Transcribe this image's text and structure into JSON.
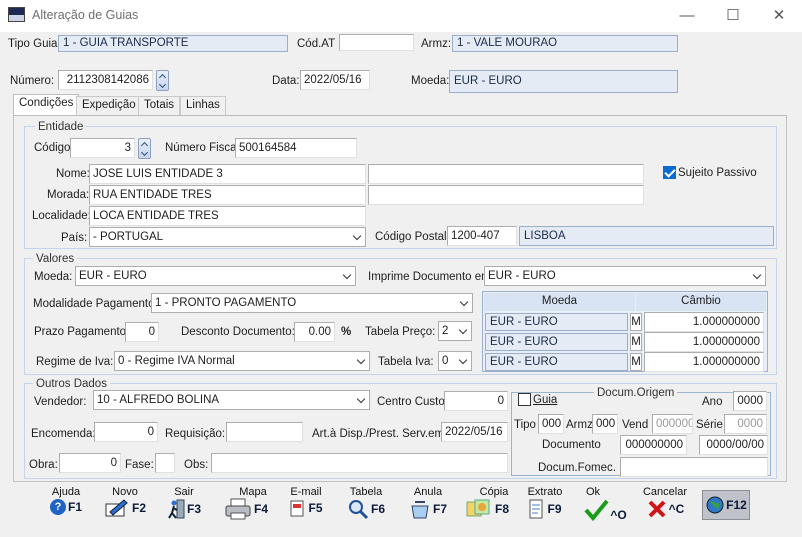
{
  "window": {
    "title": "Alteração de Guias",
    "minimize": "—",
    "maximize": "☐",
    "close": "✕"
  },
  "header": {
    "tipo_guia_label": "Tipo Guia:",
    "tipo_guia_value": "1 - GUIA TRANSPORTE",
    "cod_at_label": "Cód.AT",
    "cod_at_value": "",
    "armz_label": "Armz:",
    "armz_value": "1 - VALE MOURAO",
    "numero_label": "Número:",
    "numero_value": "2112308142086",
    "data_label": "Data:",
    "data_value": "2022/05/16",
    "moeda_label": "Moeda:",
    "moeda_value": "EUR - EURO"
  },
  "tabs": [
    {
      "label": "Condições",
      "active": true
    },
    {
      "label": "Expedição"
    },
    {
      "label": "Totais"
    },
    {
      "label": "Linhas"
    }
  ],
  "entidade": {
    "group_label": "Entidade",
    "codigo_label": "Código:",
    "codigo_value": "3",
    "nif_label": "Número Fiscal:",
    "nif_value": "500164584",
    "nome_label": "Nome:",
    "nome_value": "JOSE LUIS ENTIDADE 3",
    "nome2_value": "",
    "morada_label": "Morada:",
    "morada_value": "RUA ENTIDADE TRES",
    "morada2_value": "",
    "localidade_label": "Localidade:",
    "localidade_value": "LOCA ENTIDADE TRES",
    "pais_label": "País:",
    "pais_value": "- PORTUGAL",
    "cp_label": "Código Postal:",
    "cp_value": "1200-407",
    "cp_localidade": "LISBOA",
    "sujeito_passivo_label": "Sujeito Passivo",
    "sujeito_passivo_checked": true
  },
  "valores": {
    "group_label": "Valores",
    "moeda_label": "Moeda:",
    "moeda_value": "EUR - EURO",
    "imprime_label": "Imprime Documento em:",
    "imprime_value": "EUR - EURO",
    "modalidade_label": "Modalidade Pagamento:",
    "modalidade_value": "1 - PRONTO PAGAMENTO",
    "prazo_label": "Prazo Pagamento:",
    "prazo_value": "0",
    "desconto_label": "Desconto Documento:",
    "desconto_value": "0.00",
    "percent": "%",
    "tabela_preco_label": "Tabela Preço:",
    "tabela_preco_value": "2",
    "regime_label": "Regime de Iva:",
    "regime_value": "0 - Regime IVA Normal",
    "tabela_iva_label": "Tabela Iva:",
    "tabela_iva_value": "0",
    "table": {
      "headers": [
        "Moeda",
        "Câmbio"
      ],
      "rows": [
        {
          "moeda": "EUR - EURO",
          "m": "M",
          "cambio": "1.000000000"
        },
        {
          "moeda": "EUR - EURO",
          "m": "M",
          "cambio": "1.000000000"
        },
        {
          "moeda": "EUR - EURO",
          "m": "M",
          "cambio": "1.000000000"
        }
      ]
    }
  },
  "outros": {
    "group_label": "Outros Dados",
    "vendedor_label": "Vendedor:",
    "vendedor_value": "10 - ALFREDO BOLINA",
    "centro_label": "Centro Custo:",
    "centro_value": "0",
    "encomenda_label": "Encomenda:",
    "encomenda_value": "0",
    "requisicao_label": "Requisição:",
    "requisicao_value": "",
    "art_label": "Art.à Disp./Prest. Serv.em:",
    "art_value": "2022/05/16",
    "obra_label": "Obra:",
    "obra_value": "0",
    "fase_label": "Fase:",
    "fase_value": "",
    "obs_label": "Obs:",
    "obs_value": ""
  },
  "origem": {
    "guia_label": "Guia",
    "guia_checked": false,
    "title": "Docum.Origem",
    "ano_label": "Ano",
    "ano_value": "0000",
    "tipo_label": "Tipo",
    "tipo_value": "000",
    "armz_label": "Armz",
    "armz_value": "000",
    "vend_label": "Vend",
    "vend_value": "000000",
    "serie_label": "Série",
    "serie_value": "0000",
    "documento_label": "Documento",
    "documento_value": "000000000",
    "documento_data": "0000/00/00",
    "fornec_label": "Docum.Fomec.",
    "fornec_value": ""
  },
  "fkeys": [
    {
      "caption": "Ajuda",
      "key": "F1",
      "icon": "help-icon"
    },
    {
      "caption": "Novo",
      "key": "F2",
      "icon": "new-icon"
    },
    {
      "caption": "Sair",
      "key": "F3",
      "icon": "exit-icon"
    },
    {
      "caption": "Mapa",
      "key": "F4",
      "icon": "printer-icon"
    },
    {
      "caption": "E-mail",
      "key": "F5",
      "icon": "email-icon"
    },
    {
      "caption": "Tabela",
      "key": "F6",
      "icon": "table-search-icon"
    },
    {
      "caption": "Anula",
      "key": "F7",
      "icon": "cancel-doc-icon"
    },
    {
      "caption": "Cópia",
      "key": "F8",
      "icon": "copy-icon"
    },
    {
      "caption": "Extrato",
      "key": "F9",
      "icon": "extract-icon"
    },
    {
      "caption": "Ok",
      "key": "^O",
      "icon": "check-icon"
    },
    {
      "caption": "Cancelar",
      "key": "^C",
      "icon": "x-icon"
    },
    {
      "caption": "",
      "key": "F12",
      "icon": "web-globe-icon"
    }
  ]
}
